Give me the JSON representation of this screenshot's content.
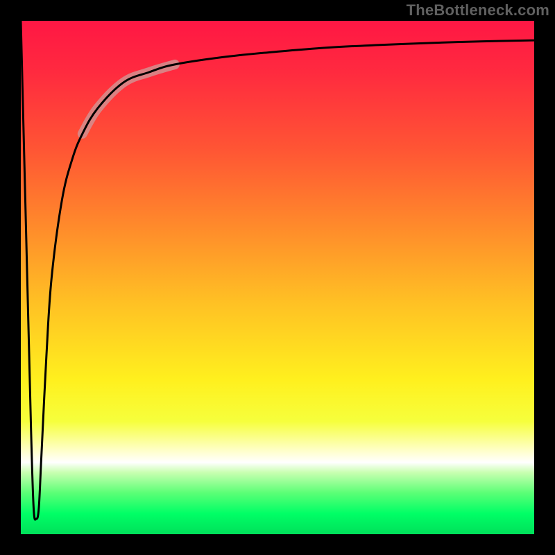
{
  "watermark": "TheBottleneck.com",
  "colors": {
    "bg": "#000000",
    "watermark_text": "#606060",
    "curve_stroke": "#000000",
    "highlight_stroke": "#d48f8f",
    "gradient_stops": [
      "#ff1744",
      "#ff5534",
      "#ffc124",
      "#fff01e",
      "#ffffff",
      "#00ff66"
    ]
  },
  "chart_data": {
    "type": "line",
    "title": "",
    "xlabel": "",
    "ylabel": "",
    "xlim": [
      0,
      100
    ],
    "ylim": [
      0,
      100
    ],
    "grid": false,
    "legend": false,
    "series": [
      {
        "name": "curve",
        "x": [
          0,
          1,
          2,
          2.5,
          3,
          3.5,
          4,
          5,
          6,
          8,
          10,
          12,
          15,
          20,
          25,
          30,
          40,
          50,
          60,
          70,
          80,
          90,
          100
        ],
        "values": [
          100,
          60,
          20,
          5,
          3,
          5,
          15,
          35,
          50,
          65,
          73,
          78,
          83,
          88,
          90,
          91.5,
          93,
          94,
          94.8,
          95.3,
          95.7,
          96,
          96.2
        ]
      }
    ],
    "highlight_range_x": [
      15,
      25
    ],
    "notes": "Values are read from the unlabeled axes using the plot extents as 0–100 in each direction. The curve begins near (0,100), plunges to roughly (2.5,3), then rises steeply and asymptotically flattens toward ~96. A short pale segment highlights the curve roughly over x≈15–25."
  }
}
